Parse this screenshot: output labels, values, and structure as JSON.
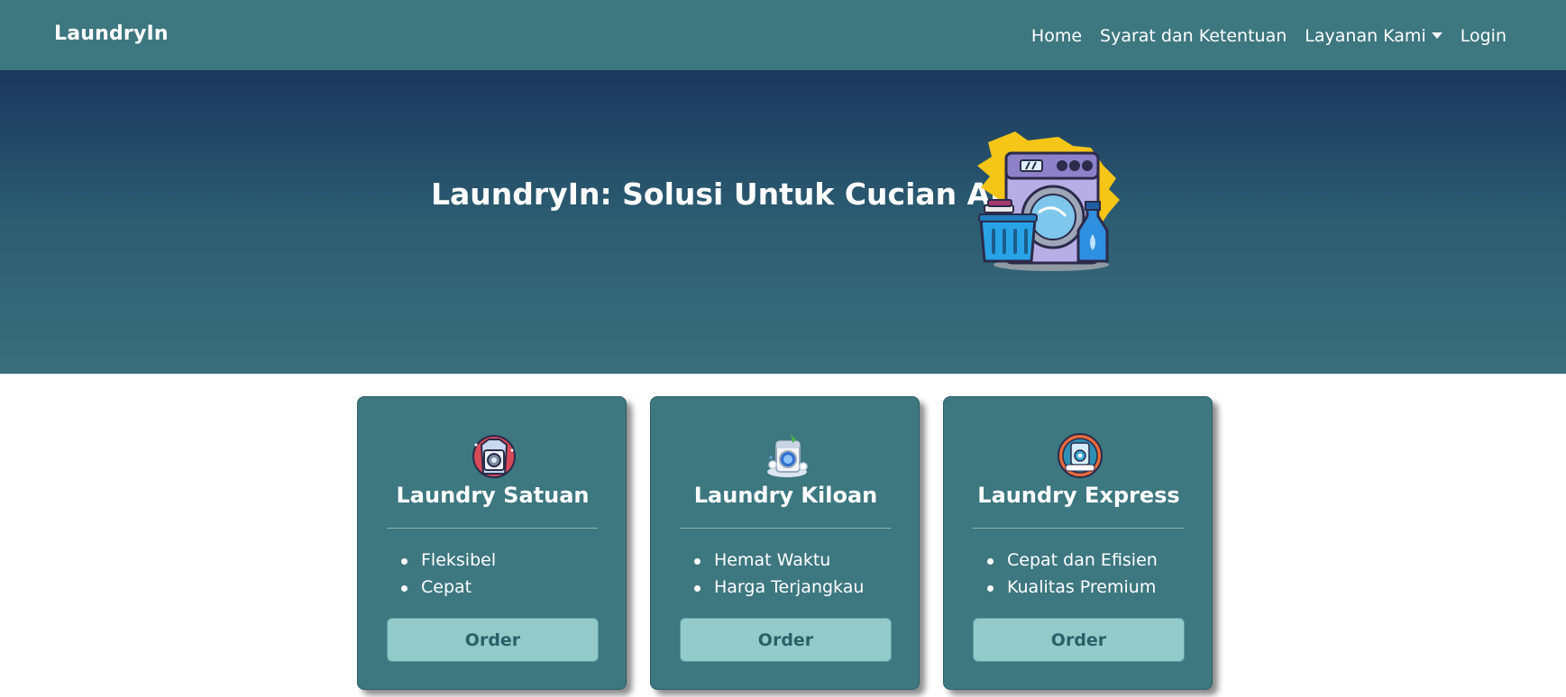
{
  "navbar": {
    "brand": "LaundryIn",
    "links": [
      {
        "label": "Home"
      },
      {
        "label": "Syarat dan Ketentuan"
      },
      {
        "label": "Layanan Kami"
      },
      {
        "label": "Login"
      }
    ]
  },
  "hero": {
    "title": "LaundryIn: Solusi Untuk Cucian Anda."
  },
  "cards": [
    {
      "title": "Laundry Satuan",
      "features": [
        "Fleksibel",
        "Cepat"
      ],
      "button": "Order"
    },
    {
      "title": "Laundry Kiloan",
      "features": [
        "Hemat Waktu",
        "Harga Terjangkau"
      ],
      "button": "Order"
    },
    {
      "title": "Laundry Express",
      "features": [
        "Cepat dan Efisien",
        "Kualitas Premium"
      ],
      "button": "Order"
    }
  ],
  "colors": {
    "navbar_bg": "#3d7780",
    "hero_gradient_top": "#1b375e",
    "hero_gradient_bottom": "#3a6f7c",
    "card_bg": "#3d7780",
    "button_bg": "#93caca",
    "button_text": "#2c5f68"
  },
  "icons": {
    "hero": "washing-machine-illustration",
    "cards": [
      "shirt-washer-icon",
      "kiloan-washer-icon",
      "express-washer-badge-icon"
    ],
    "dropdown": "caret-down-icon"
  }
}
